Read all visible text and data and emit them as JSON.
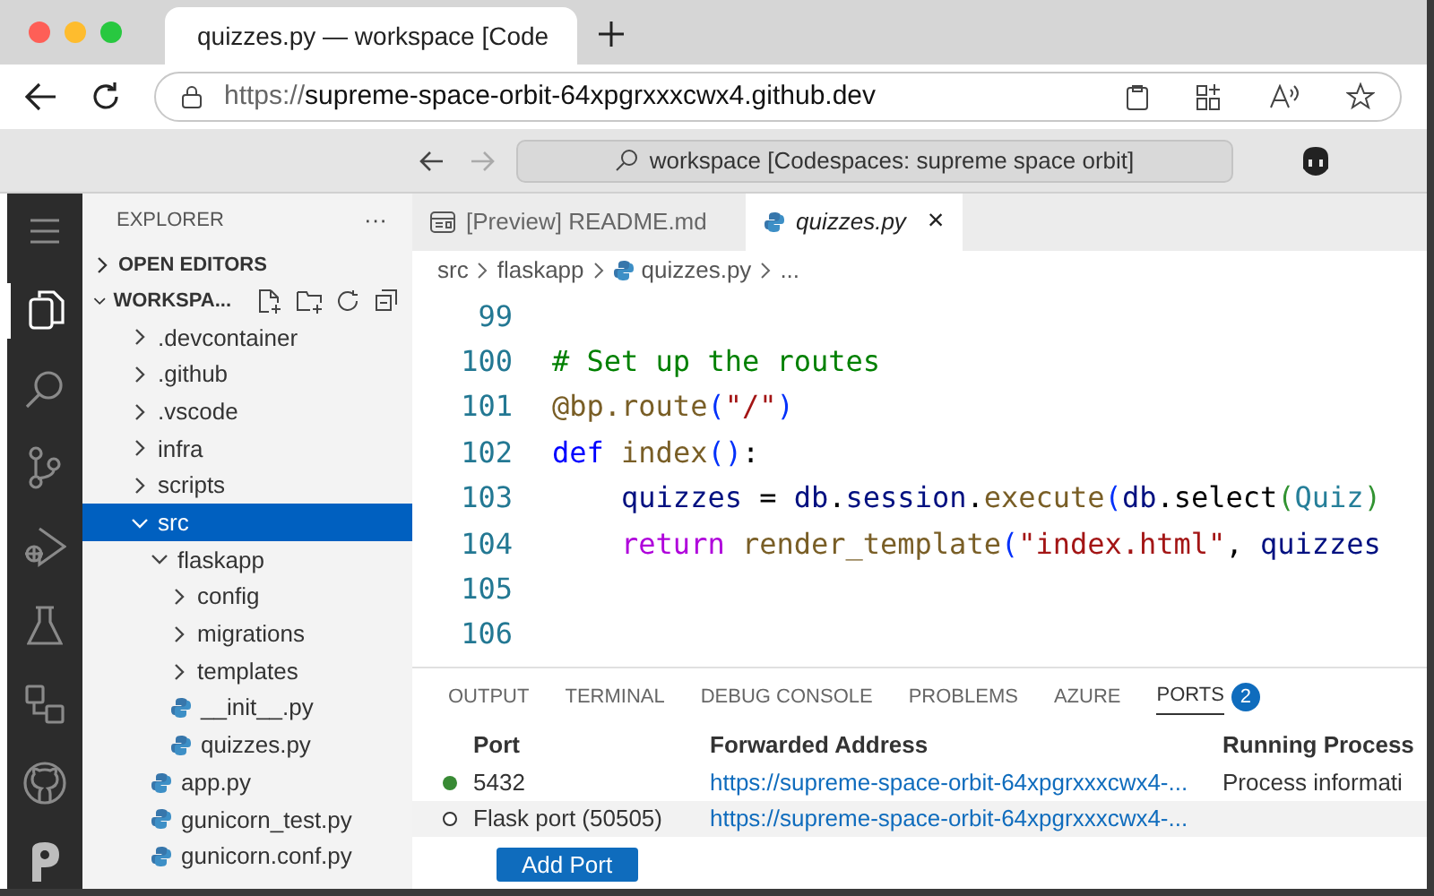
{
  "browser": {
    "tab_title": "quizzes.py — workspace [Code",
    "url_prefix": "https://",
    "url_host": "supreme-space-orbit-64xpgrxxxcwx4.github.dev"
  },
  "title_bar": {
    "command_center": "workspace [Codespaces: supreme space orbit]"
  },
  "activity_bar": [
    {
      "kind": "menu",
      "selected": false
    },
    {
      "kind": "files",
      "selected": true
    },
    {
      "kind": "search",
      "selected": false
    },
    {
      "kind": "branch",
      "selected": false
    },
    {
      "kind": "debug",
      "selected": false
    },
    {
      "kind": "flask",
      "selected": false
    },
    {
      "kind": "remote",
      "selected": false
    },
    {
      "kind": "github",
      "selected": false
    },
    {
      "kind": "p",
      "selected": false
    }
  ],
  "sidebar": {
    "title": "EXPLORER",
    "more": "···",
    "sections": [
      {
        "label": "OPEN EDITORS",
        "expanded": false
      },
      {
        "label": "WORKSPA...",
        "expanded": true
      }
    ],
    "tree": [
      {
        "label": ".devcontainer",
        "kind": "folder",
        "expanded": false,
        "selected": false
      },
      {
        "label": ".github",
        "kind": "folder",
        "expanded": false,
        "selected": false
      },
      {
        "label": ".vscode",
        "kind": "folder",
        "expanded": false,
        "selected": false
      },
      {
        "label": "infra",
        "kind": "folder",
        "expanded": false,
        "selected": false
      },
      {
        "label": "scripts",
        "kind": "folder",
        "expanded": false,
        "selected": false
      },
      {
        "label": "src",
        "kind": "folder",
        "expanded": true,
        "selected": true,
        "children": [
          {
            "label": "flaskapp",
            "kind": "folder",
            "expanded": true,
            "selected": false,
            "children": [
              {
                "label": "config",
                "kind": "folder",
                "expanded": false,
                "selected": false
              },
              {
                "label": "migrations",
                "kind": "folder",
                "expanded": false,
                "selected": false
              },
              {
                "label": "templates",
                "kind": "folder",
                "expanded": false,
                "selected": false
              },
              {
                "label": "__init__.py",
                "kind": "python",
                "selected": false
              },
              {
                "label": "quizzes.py",
                "kind": "python",
                "selected": false
              }
            ]
          },
          {
            "label": "app.py",
            "kind": "python",
            "selected": false
          },
          {
            "label": "gunicorn_test.py",
            "kind": "python",
            "selected": false
          },
          {
            "label": "gunicorn.conf.py",
            "kind": "python",
            "selected": false
          }
        ]
      }
    ]
  },
  "editor": {
    "tabs": [
      {
        "label": "[Preview] README.md",
        "kind": "preview",
        "selected": false
      },
      {
        "label": "quizzes.py",
        "kind": "python",
        "selected": true,
        "close": "×"
      }
    ],
    "breadcrumb": [
      {
        "label": "src",
        "kind": "text"
      },
      {
        "label": "flaskapp",
        "kind": "text"
      },
      {
        "label": "quizzes.py",
        "kind": "python"
      },
      {
        "label": "...",
        "kind": "text"
      }
    ],
    "lines": [
      {
        "number": "99"
      },
      {
        "number": "100",
        "tokens": [
          {
            "text": "# Set up the routes",
            "kind": "comment"
          }
        ]
      },
      {
        "number": "101",
        "tokens": [
          {
            "text": "@bp.route",
            "kind": "function"
          },
          {
            "text": "(",
            "kind": "bracket"
          },
          {
            "text": "\"/\"",
            "kind": "string"
          },
          {
            "text": ")",
            "kind": "bracket"
          }
        ]
      },
      {
        "number": "102",
        "tokens": [
          {
            "text": "def",
            "kind": "keyword"
          },
          {
            "text": " index",
            "kind": "function"
          },
          {
            "text": "()",
            "kind": "bracket"
          },
          {
            "text": ":",
            "kind": "plain"
          }
        ]
      },
      {
        "number": "103",
        "tokens": [
          {
            "text": "    quizzes",
            "kind": "variable"
          },
          {
            "text": " = ",
            "kind": "plain"
          },
          {
            "text": "db",
            "kind": "variable"
          },
          {
            "text": ".",
            "kind": "plain"
          },
          {
            "text": "session",
            "kind": "variable"
          },
          {
            "text": ".",
            "kind": "plain"
          },
          {
            "text": "execute",
            "kind": "function"
          },
          {
            "text": "(",
            "kind": "bracket"
          },
          {
            "text": "db",
            "kind": "variable"
          },
          {
            "text": ".",
            "kind": "plain"
          },
          {
            "text": "select",
            "kind": "plain"
          },
          {
            "text": "(",
            "kind": "bracket2"
          },
          {
            "text": "Quiz",
            "kind": "class"
          },
          {
            "text": ")",
            "kind": "bracket2"
          }
        ]
      },
      {
        "number": "104",
        "tokens": [
          {
            "text": "    return",
            "kind": "control"
          },
          {
            "text": " render_template",
            "kind": "function"
          },
          {
            "text": "(",
            "kind": "bracket"
          },
          {
            "text": "\"index.html\"",
            "kind": "string"
          },
          {
            "text": ", ",
            "kind": "plain"
          },
          {
            "text": "quizzes",
            "kind": "variable"
          }
        ]
      },
      {
        "number": "105"
      },
      {
        "number": "106"
      }
    ]
  },
  "panel": {
    "tabs": [
      {
        "label": "OUTPUT",
        "selected": false
      },
      {
        "label": "TERMINAL",
        "selected": false
      },
      {
        "label": "DEBUG CONSOLE",
        "selected": false
      },
      {
        "label": "PROBLEMS",
        "selected": false
      },
      {
        "label": "AZURE",
        "selected": false
      },
      {
        "label": "PORTS",
        "selected": true,
        "badge": "2"
      }
    ],
    "columns": [
      "Port",
      "Forwarded Address",
      "Running Process"
    ],
    "rows": [
      {
        "running": true,
        "selected": false,
        "port": "5432",
        "address": "https://supreme-space-orbit-64xpgrxxxcwx4-...",
        "process": "Process informati"
      },
      {
        "running": false,
        "selected": true,
        "port": "Flask port (50505)",
        "address": "https://supreme-space-orbit-64xpgrxxxcwx4-..."
      }
    ],
    "add_button": "Add Port"
  }
}
